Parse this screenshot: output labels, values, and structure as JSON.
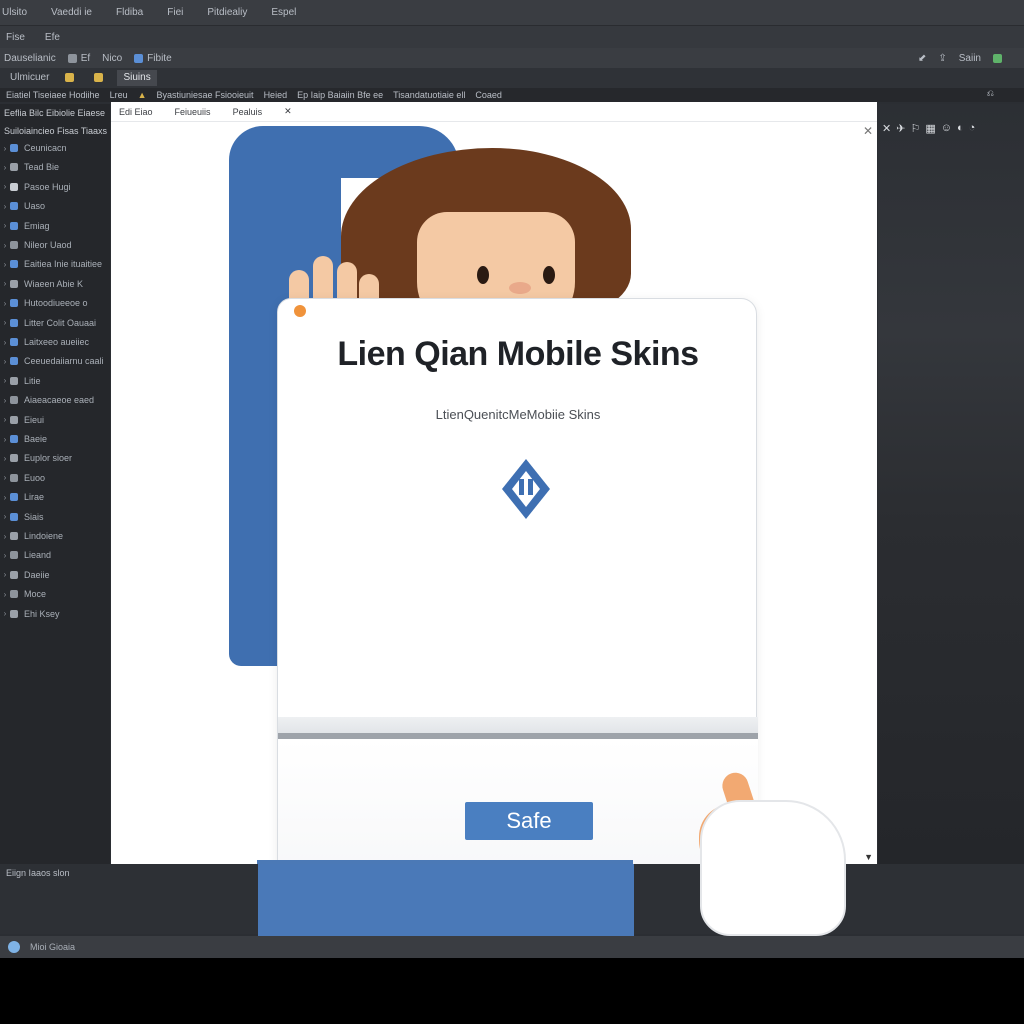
{
  "menubar": {
    "items": [
      "Ulsito",
      "Vaeddi ie",
      "Fldiba",
      "Fiei",
      "Pitdiealiy",
      "Espel"
    ]
  },
  "menubar2": {
    "items": [
      "Fise",
      "Efe"
    ]
  },
  "toolbar": {
    "items": [
      "Dauselianic",
      "Ef",
      "Nico",
      "Fibite"
    ],
    "right_label": "Saiin"
  },
  "tabs": {
    "items": [
      "Ulmicuer",
      "Siuins"
    ]
  },
  "breadcrumb": {
    "items": [
      "Eiatiel Tiseiaee Hodiihe",
      "Lreu",
      "Byastiuniesae Fsiooieuit",
      "Heied",
      "Ep Iaip Baiaiin Bfe ee",
      "Tisandatuotiaie ell",
      "Coaed"
    ]
  },
  "sidebar": {
    "title": "Eeflia Bilc Eibiolie Eiaese",
    "subtitle": "Suiloiaincieo Fisas Tiaaxs",
    "items": [
      "Ceunicacn",
      "Tead Bie",
      "Pasoe Hugi",
      "Uaso",
      "Emiag",
      "Nileor Uaod",
      "Eaitiea Inie ituaitiee",
      "Wiaeen Abie K",
      "Hutoodiueeoe o",
      "Litter Colit Oauaai",
      "Laitxeeo aueiiec",
      "Ceeuedaiiarnu caali",
      "Litie",
      "Aiaeacaeoe eaed",
      "Eieui",
      "Baeie",
      "Euplor sioer",
      "Euoo",
      "Lirae",
      "Siais",
      "Lindoiene",
      "Lieand",
      "Daeiie",
      "Moce",
      "Ehi Ksey"
    ]
  },
  "canvas": {
    "tabs": [
      "Edi Eiao",
      "Feiueuiis",
      "Pealuis"
    ]
  },
  "card": {
    "title": "Lien Qian Mobile Skins",
    "subtitle": "LtienQuenitcMeMobiie Skins",
    "button_label": "Safe"
  },
  "right_panel": {
    "icons": [
      "✕",
      "✈",
      "⚐",
      "▦",
      "☺",
      "◐",
      "◔"
    ]
  },
  "lower": {
    "label": "Eiign Iaaos slon"
  },
  "statusbar": {
    "label": "Mioi Gioaia"
  },
  "colors": {
    "accent": "#4a7fc1",
    "dialog_dot": "#f0933b",
    "phone": "#3f6fb0",
    "chrome": "#2b2e33"
  }
}
